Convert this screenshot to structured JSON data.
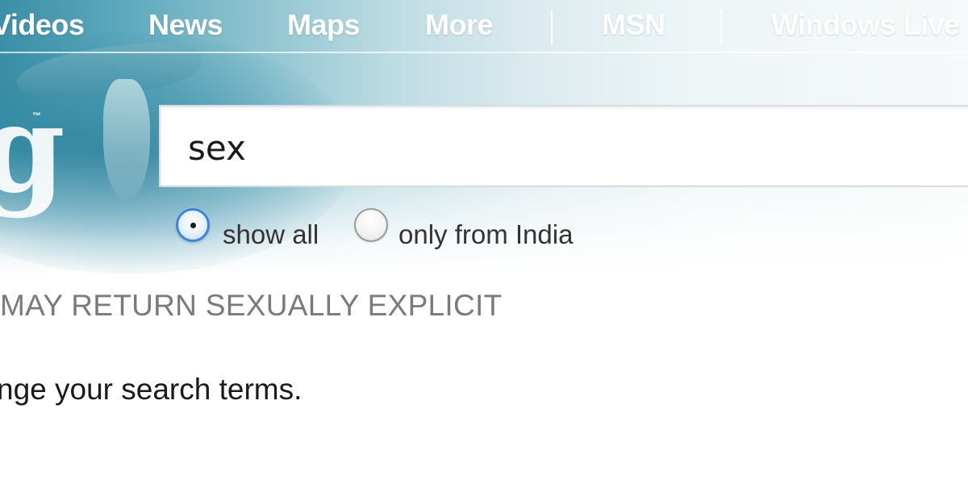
{
  "topnav": {
    "items": [
      {
        "label": "Videos"
      },
      {
        "label": "News"
      },
      {
        "label": "Maps"
      },
      {
        "label": "More"
      },
      {
        "label": "MSN"
      },
      {
        "label": "Windows Live"
      }
    ]
  },
  "logo": {
    "letter": "g",
    "tm": "™"
  },
  "search": {
    "value": "sex",
    "placeholder": ""
  },
  "filter": {
    "options": [
      {
        "label": "show all",
        "checked": true
      },
      {
        "label": "only from India",
        "checked": false
      }
    ]
  },
  "warning": {
    "text": "MAY RETURN SEXUALLY EXPLICIT"
  },
  "message": {
    "text": "nge your search terms."
  },
  "colors": {
    "header_water": "#3b8fa6",
    "radio_selected": "#3f84cf",
    "warning_text": "#7a7a7a",
    "body_text": "#1a1a1a"
  }
}
